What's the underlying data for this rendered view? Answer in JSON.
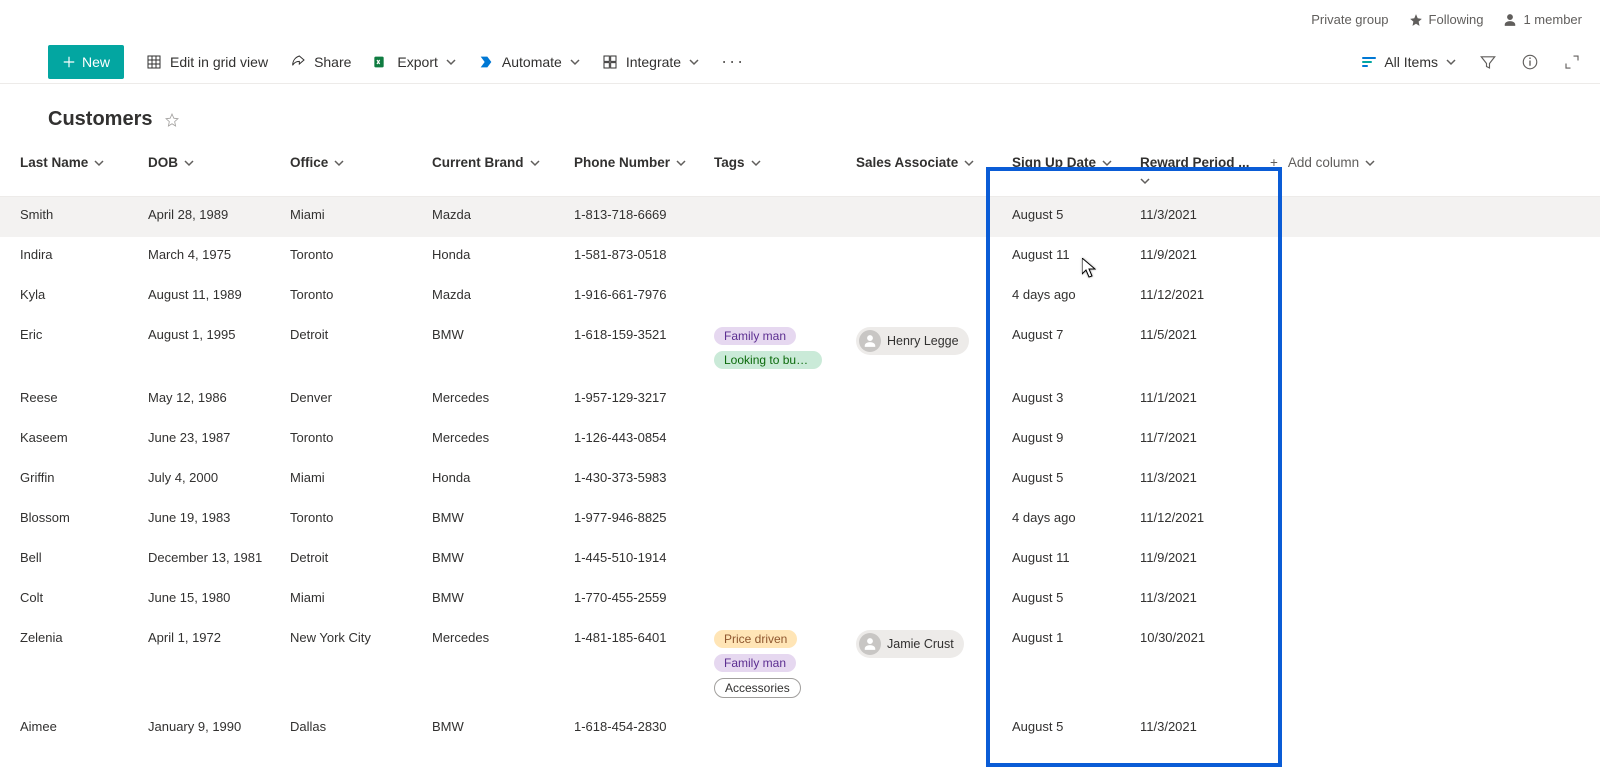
{
  "topbar": {
    "group": "Private group",
    "following": "Following",
    "members": "1 member"
  },
  "cmd": {
    "new": "New",
    "editGrid": "Edit in grid view",
    "share": "Share",
    "export": "Export",
    "automate": "Automate",
    "integrate": "Integrate",
    "allItems": "All Items"
  },
  "title": "Customers",
  "columns": {
    "lastName": "Last Name",
    "dob": "DOB",
    "office": "Office",
    "brand": "Current Brand",
    "phone": "Phone Number",
    "tags": "Tags",
    "sales": "Sales Associate",
    "signup": "Sign Up Date",
    "reward": "Reward Period ...",
    "add": "Add column"
  },
  "rows": [
    {
      "last": "Smith",
      "dob": "April 28, 1989",
      "office": "Miami",
      "brand": "Mazda",
      "phone": "1-813-718-6669",
      "tags": [],
      "sales": "",
      "signup": "August 5",
      "reward": "11/3/2021"
    },
    {
      "last": "Indira",
      "dob": "March 4, 1975",
      "office": "Toronto",
      "brand": "Honda",
      "phone": "1-581-873-0518",
      "tags": [],
      "sales": "",
      "signup": "August 11",
      "reward": "11/9/2021"
    },
    {
      "last": "Kyla",
      "dob": "August 11, 1989",
      "office": "Toronto",
      "brand": "Mazda",
      "phone": "1-916-661-7976",
      "tags": [],
      "sales": "",
      "signup": "4 days ago",
      "reward": "11/12/2021"
    },
    {
      "last": "Eric",
      "dob": "August 1, 1995",
      "office": "Detroit",
      "brand": "BMW",
      "phone": "1-618-159-3521",
      "tags": [
        {
          "t": "Family man",
          "c": "purple"
        },
        {
          "t": "Looking to buy s...",
          "c": "green"
        }
      ],
      "sales": "Henry Legge",
      "signup": "August 7",
      "reward": "11/5/2021"
    },
    {
      "last": "Reese",
      "dob": "May 12, 1986",
      "office": "Denver",
      "brand": "Mercedes",
      "phone": "1-957-129-3217",
      "tags": [],
      "sales": "",
      "signup": "August 3",
      "reward": "11/1/2021"
    },
    {
      "last": "Kaseem",
      "dob": "June 23, 1987",
      "office": "Toronto",
      "brand": "Mercedes",
      "phone": "1-126-443-0854",
      "tags": [],
      "sales": "",
      "signup": "August 9",
      "reward": "11/7/2021"
    },
    {
      "last": "Griffin",
      "dob": "July 4, 2000",
      "office": "Miami",
      "brand": "Honda",
      "phone": "1-430-373-5983",
      "tags": [],
      "sales": "",
      "signup": "August 5",
      "reward": "11/3/2021"
    },
    {
      "last": "Blossom",
      "dob": "June 19, 1983",
      "office": "Toronto",
      "brand": "BMW",
      "phone": "1-977-946-8825",
      "tags": [],
      "sales": "",
      "signup": "4 days ago",
      "reward": "11/12/2021"
    },
    {
      "last": "Bell",
      "dob": "December 13, 1981",
      "office": "Detroit",
      "brand": "BMW",
      "phone": "1-445-510-1914",
      "tags": [],
      "sales": "",
      "signup": "August 11",
      "reward": "11/9/2021"
    },
    {
      "last": "Colt",
      "dob": "June 15, 1980",
      "office": "Miami",
      "brand": "BMW",
      "phone": "1-770-455-2559",
      "tags": [],
      "sales": "",
      "signup": "August 5",
      "reward": "11/3/2021"
    },
    {
      "last": "Zelenia",
      "dob": "April 1, 1972",
      "office": "New York City",
      "brand": "Mercedes",
      "phone": "1-481-185-6401",
      "tags": [
        {
          "t": "Price driven",
          "c": "orange"
        },
        {
          "t": "Family man",
          "c": "purple"
        },
        {
          "t": "Accessories",
          "c": "gray"
        }
      ],
      "sales": "Jamie Crust",
      "signup": "August 1",
      "reward": "10/30/2021"
    },
    {
      "last": "Aimee",
      "dob": "January 9, 1990",
      "office": "Dallas",
      "brand": "BMW",
      "phone": "1-618-454-2830",
      "tags": [],
      "sales": "",
      "signup": "August 5",
      "reward": "11/3/2021"
    }
  ]
}
